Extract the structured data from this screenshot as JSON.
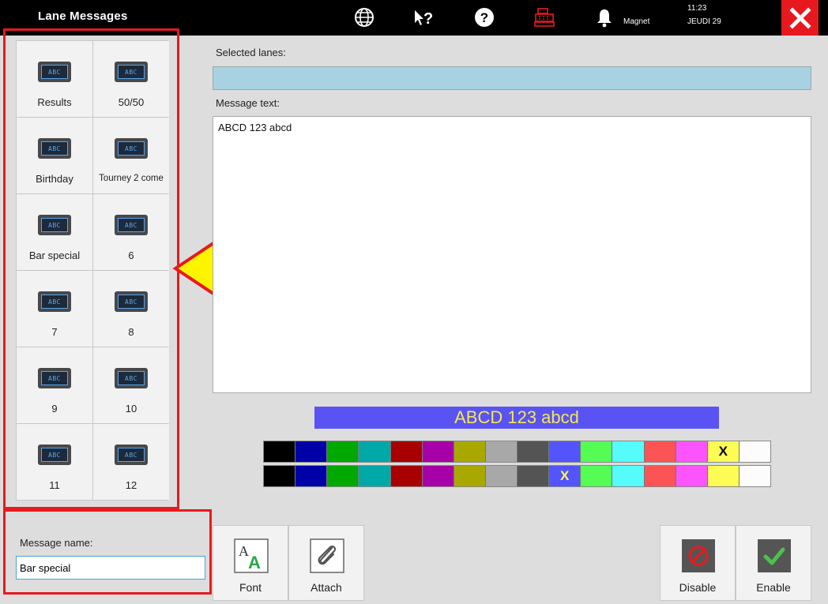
{
  "window": {
    "title": "Lane Messages"
  },
  "topbar": {
    "icons": [
      "globe-icon",
      "help-query-icon",
      "help-icon",
      "cash-register-icon",
      "bell-icon"
    ],
    "user": "Magnet",
    "time": "11:23",
    "date": "JEUDI 29"
  },
  "message_tiles": [
    {
      "label": "Results",
      "icon": "abc-screen-icon"
    },
    {
      "label": "50/50",
      "icon": "abc-screen-icon"
    },
    {
      "label": "Birthday",
      "icon": "abc-screen-icon"
    },
    {
      "label": "Tourney 2 come",
      "icon": "abc-screen-icon"
    },
    {
      "label": "Bar special",
      "icon": "abc-screen-icon"
    },
    {
      "label": "6",
      "icon": "abc-screen-icon"
    },
    {
      "label": "7",
      "icon": "abc-screen-icon"
    },
    {
      "label": "8",
      "icon": "abc-screen-icon"
    },
    {
      "label": "9",
      "icon": "abc-screen-icon"
    },
    {
      "label": "10",
      "icon": "abc-screen-icon"
    },
    {
      "label": "11",
      "icon": "abc-screen-icon"
    },
    {
      "label": "12",
      "icon": "abc-screen-icon"
    }
  ],
  "tile_icon_text": "ABC",
  "editor": {
    "selected_lanes_label": "Selected lanes:",
    "selected_lanes_value": "",
    "message_text_label": "Message text:",
    "message_text_value": "ABCD 123 abcd",
    "preview_text": "ABCD 123 abcd",
    "preview_bg": "#5a53f3",
    "preview_fg": "#f4e94a"
  },
  "palette_colors": [
    "#000000",
    "#0000a8",
    "#00a800",
    "#00a8a8",
    "#a80000",
    "#a800a8",
    "#a8a800",
    "#a8a8a8",
    "#545454",
    "#5454fc",
    "#54fc54",
    "#54fcfc",
    "#fc5454",
    "#fc54fc",
    "#fcfc54",
    "#fcfcfc"
  ],
  "foreground_palette": {
    "selected_index": 14,
    "marker": "X"
  },
  "background_palette": {
    "selected_index": 9,
    "marker": "X"
  },
  "message_name": {
    "label": "Message name:",
    "value": "Bar special"
  },
  "buttons": {
    "font": "Font",
    "attach": "Attach",
    "disable": "Disable",
    "enable": "Enable"
  },
  "accent": "#e8191e"
}
